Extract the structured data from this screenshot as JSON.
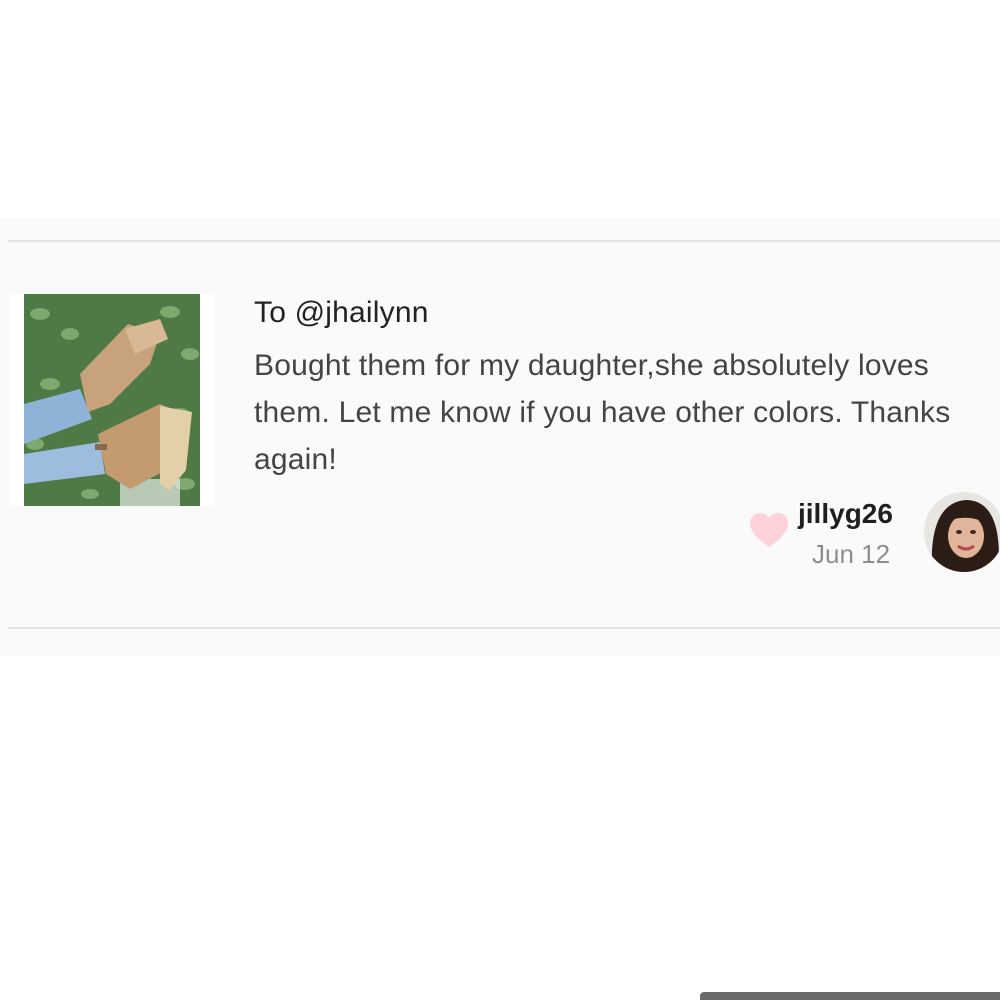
{
  "review": {
    "recipient": "To @jhailynn",
    "message": "Bought them for my daughter,she absolutely loves them. Let me know if you have other colors. Thanks again!",
    "username": "jillyg26",
    "date": "Jun 12",
    "like_icon": "heart-icon",
    "product_image": "sandals-photo",
    "colors": {
      "heart": "#ffd1d9",
      "date": "#8e8e8e",
      "text": "#444444"
    }
  }
}
